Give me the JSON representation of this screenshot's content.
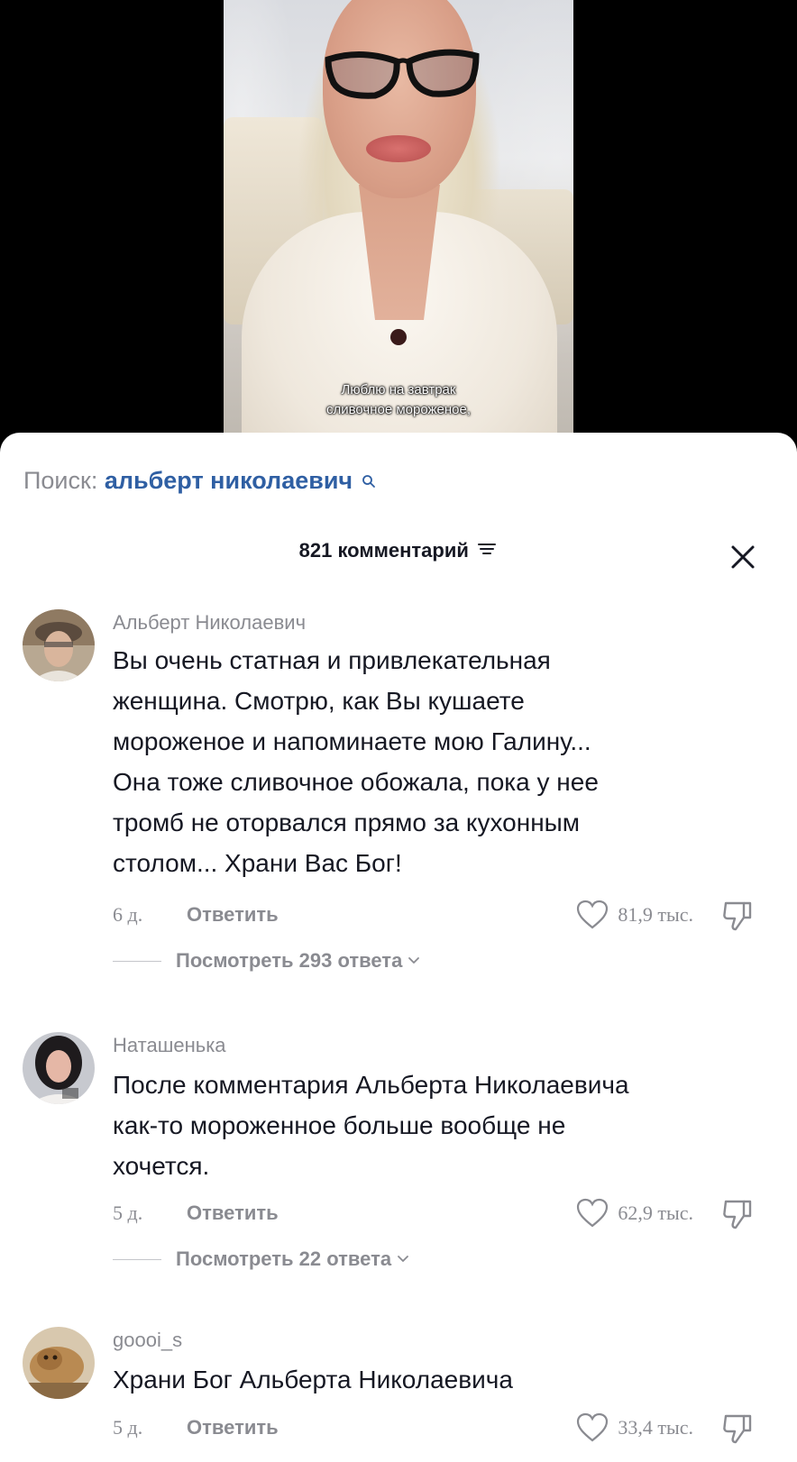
{
  "video": {
    "caption_line1": "Люблю на завтрак",
    "caption_line2": "сливочное мороженое,"
  },
  "search": {
    "prefix": "Поиск:",
    "query": "альберт николаевич",
    "icon": "search-icon"
  },
  "comments_header": {
    "count_label": "821 комментарий",
    "filter_icon": "filter-icon",
    "close_icon": "close-icon"
  },
  "comments": [
    {
      "username": "Альберт Николаевич",
      "lines": [
        "Вы очень статная и привлекательная",
        "женщина. Смотрю, как Вы кушаете",
        "мороженое и напоминаете мою Галину...",
        "Она тоже сливочное обожала, пока у нее",
        "тромб не оторвался прямо за кухонным",
        "столом... Храни Вас Бог!"
      ],
      "age": "6 д.",
      "reply_label": "Ответить",
      "likes": "81,9 тыс.",
      "replies_label": "Посмотреть 293 ответа"
    },
    {
      "username": "Наташенька",
      "lines": [
        "После комментария Альберта Николаевича",
        "как-то мороженное больше вообще не",
        "хочется."
      ],
      "age": "5 д.",
      "reply_label": "Ответить",
      "likes": "62,9 тыс.",
      "replies_label": "Посмотреть 22 ответа"
    },
    {
      "username": "goooi_s",
      "lines": [
        "Храни Бог Альберта Николаевича"
      ],
      "age": "5 д.",
      "reply_label": "Ответить",
      "likes": "33,4 тыс."
    }
  ],
  "colors": {
    "accent_link": "#2f5fa3",
    "muted_text": "#8a8b91",
    "primary_text": "#161823",
    "sheet_bg": "#ffffff",
    "video_bg": "#000000"
  }
}
